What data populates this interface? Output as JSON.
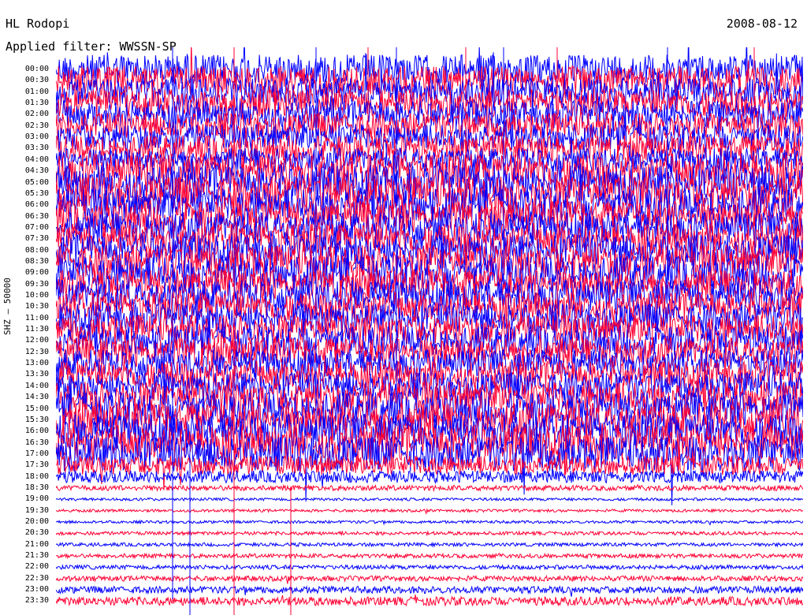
{
  "header": {
    "station": "HL Rodopi",
    "date": "2008-08-12",
    "filter_label": "Applied filter:",
    "filter_value": "WWSSN-SP"
  },
  "axis": {
    "y_label": "SHZ – 50000"
  },
  "colors": {
    "trace_a": "#0000ff",
    "trace_b": "#ff0033",
    "background": "#ffffff"
  },
  "chart_data": {
    "type": "line",
    "kind": "helicorder",
    "rows": [
      "00:00",
      "00:30",
      "01:00",
      "01:30",
      "02:00",
      "02:30",
      "03:00",
      "03:30",
      "04:00",
      "04:30",
      "05:00",
      "05:30",
      "06:00",
      "06:30",
      "07:00",
      "07:30",
      "08:00",
      "08:30",
      "09:00",
      "09:30",
      "10:00",
      "10:30",
      "11:00",
      "11:30",
      "12:00",
      "12:30",
      "13:00",
      "13:30",
      "14:00",
      "14:30",
      "15:00",
      "15:30",
      "16:00",
      "16:30",
      "17:00",
      "17:30",
      "18:00",
      "18:30",
      "19:00",
      "19:30",
      "20:00",
      "20:30",
      "21:00",
      "21:30",
      "22:00",
      "22:30",
      "23:00",
      "23:30"
    ],
    "trace_colors": [
      "#0000ff",
      "#ff0033"
    ],
    "activity_by_row": [
      0.85,
      0.85,
      0.8,
      0.8,
      0.8,
      0.75,
      0.75,
      0.75,
      0.7,
      1.0,
      1.0,
      1.0,
      0.95,
      0.9,
      0.9,
      0.9,
      0.9,
      0.95,
      0.95,
      0.85,
      0.9,
      0.85,
      0.85,
      0.85,
      0.85,
      0.85,
      0.8,
      0.8,
      0.8,
      0.9,
      0.95,
      1.0,
      1.0,
      1.0,
      1.0,
      0.55,
      0.35,
      0.15,
      0.08,
      0.08,
      0.08,
      0.1,
      0.1,
      0.12,
      0.12,
      0.15,
      0.2,
      0.25
    ]
  }
}
